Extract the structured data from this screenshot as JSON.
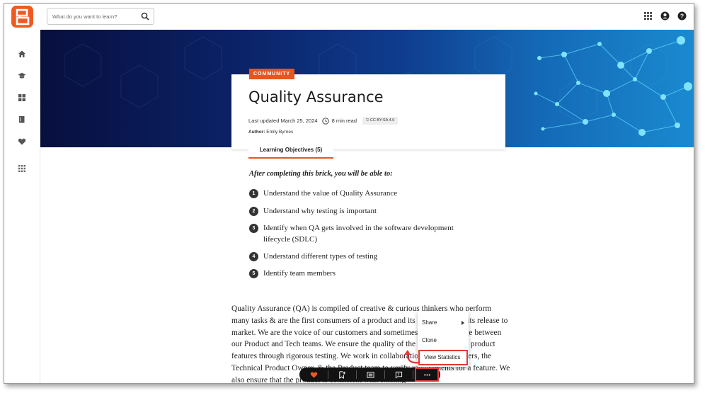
{
  "search": {
    "placeholder": "What do you want to learn?"
  },
  "brick": {
    "badge": "COMMUNITY",
    "title": "Quality Assurance",
    "last_updated": "Last updated March 25, 2024",
    "read_time": "8 min read",
    "license": "CC BY-SA 4.0",
    "author_label": "Author:",
    "author_name": "Emily Byrnes",
    "tab_label": "Learning Objectives (5)"
  },
  "objectives": {
    "intro": "After completing this brick, you will be able to:",
    "items": [
      {
        "n": "1",
        "text": "Understand the value of Quality Assurance"
      },
      {
        "n": "2",
        "text": "Understand why testing is important"
      },
      {
        "n": "3",
        "text": "Identify when QA gets involved in the software development lifecycle (SDLC)"
      },
      {
        "n": "4",
        "text": "Understand different types of testing"
      },
      {
        "n": "5",
        "text": "Identify team members"
      }
    ]
  },
  "body_text": "Quality Assurance (QA) is compiled of creative & curious thinkers who perform many tasks & are the first consumers of a product and its features before its release to market. We are the voice of our customers and sometimes act as the bridge between our Product and Tech teams. We ensure the quality of the software and its product features through rigorous testing. We work in collaboration with Developers, the Technical Product Owner, & the Product team to verify requirements for a feature. We also ensure that the product is consistent with existing",
  "menu": {
    "share": "Share",
    "clone": "Clone",
    "view_statistics": "View Statistics"
  },
  "colors": {
    "accent": "#e8551f",
    "highlight": "#e03a3a",
    "toolbar": "#121212"
  },
  "icons": {
    "rail": [
      "home-icon",
      "graduation-cap-icon",
      "dashboard-icon",
      "book-icon",
      "heart-icon",
      "apps-grid-icon"
    ],
    "toolbar": [
      "heart-icon",
      "bookmark-add-icon",
      "list-icon",
      "comment-icon",
      "more-icon"
    ]
  }
}
